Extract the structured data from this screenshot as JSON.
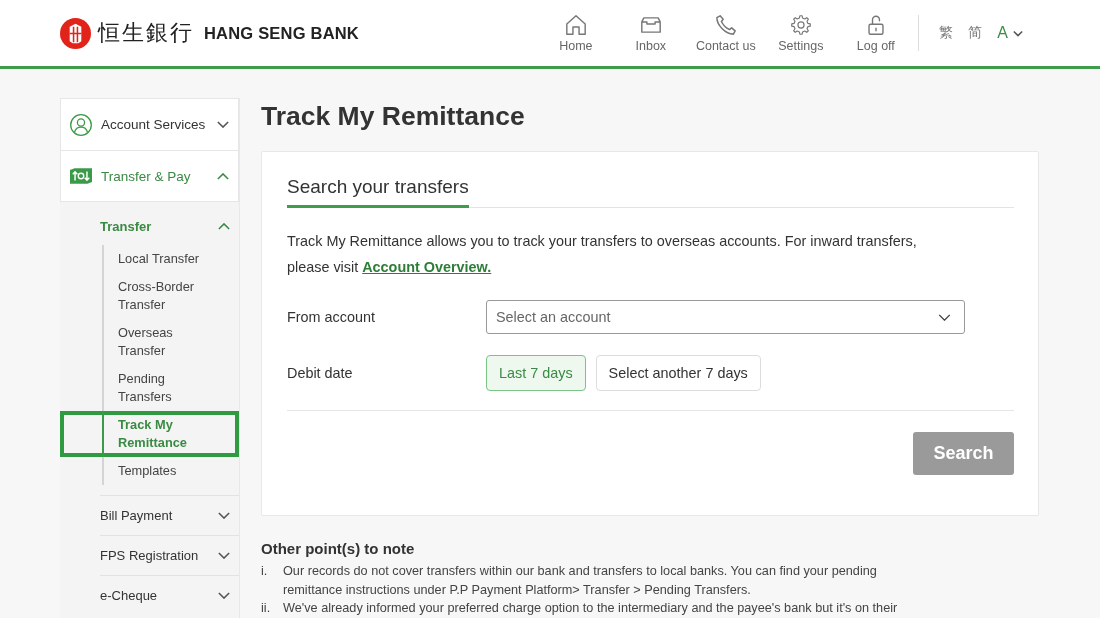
{
  "header": {
    "brand": {
      "chinese_name": "恒生銀行",
      "name": "HANG SENG BANK"
    },
    "nav": [
      {
        "kind": "home",
        "label": "Home"
      },
      {
        "kind": "inbox",
        "label": "Inbox"
      },
      {
        "kind": "contact",
        "label": "Contact us"
      },
      {
        "kind": "settings",
        "label": "Settings"
      },
      {
        "kind": "logoff",
        "label": "Log off"
      }
    ],
    "languages": [
      "繁",
      "简"
    ],
    "text_size": {
      "label": "A"
    }
  },
  "sidebar": {
    "items": [
      {
        "kind": "account",
        "label": "Account Services",
        "expanded": false
      },
      {
        "kind": "transfer",
        "label": "Transfer & Pay",
        "expanded": true,
        "children": [
          {
            "label": "Transfer",
            "expanded": true,
            "children": [
              {
                "label": "Local Transfer",
                "selected": false
              },
              {
                "label": "Cross-Border Transfer",
                "selected": false
              },
              {
                "label": "Overseas Transfer",
                "selected": false
              },
              {
                "label": "Pending Transfers",
                "selected": false
              },
              {
                "label": "Track My Remittance",
                "selected": true
              },
              {
                "label": "Templates",
                "selected": false
              }
            ]
          },
          {
            "label": "Bill Payment",
            "expanded": false
          },
          {
            "label": "FPS Registration",
            "expanded": false
          },
          {
            "label": "e-Cheque",
            "expanded": false
          }
        ]
      }
    ]
  },
  "page_title": "Track My Remittance",
  "search_card": {
    "heading": "Search your transfers",
    "intro": {
      "text": "Track My Remittance allows you to track your transfers to overseas accounts. For inward transfers, please visit",
      "link": "Account Overview."
    },
    "fields": [
      {
        "kind": "select",
        "label": "From account",
        "placeholder": "Select an account"
      },
      {
        "kind": "options",
        "label": "Debit date",
        "options": [
          {
            "label": "Last 7 days",
            "selected": true
          },
          {
            "label": "Select another 7 days",
            "selected": false
          }
        ]
      }
    ],
    "search_button": {
      "label": "Search",
      "disabled": true
    }
  },
  "notes": {
    "title": "Other point(s) to note",
    "items": [
      {
        "marker": "i.",
        "text": "Our records do not cover transfers within our bank and transfers to local banks. You can find your pending remittance instructions under P.P Payment Platform> Transfer > Pending Transfers."
      },
      {
        "marker": "ii.",
        "text": "We've already informed your preferred charge option to the intermediary and the payee's bank but it's on their"
      }
    ]
  }
}
